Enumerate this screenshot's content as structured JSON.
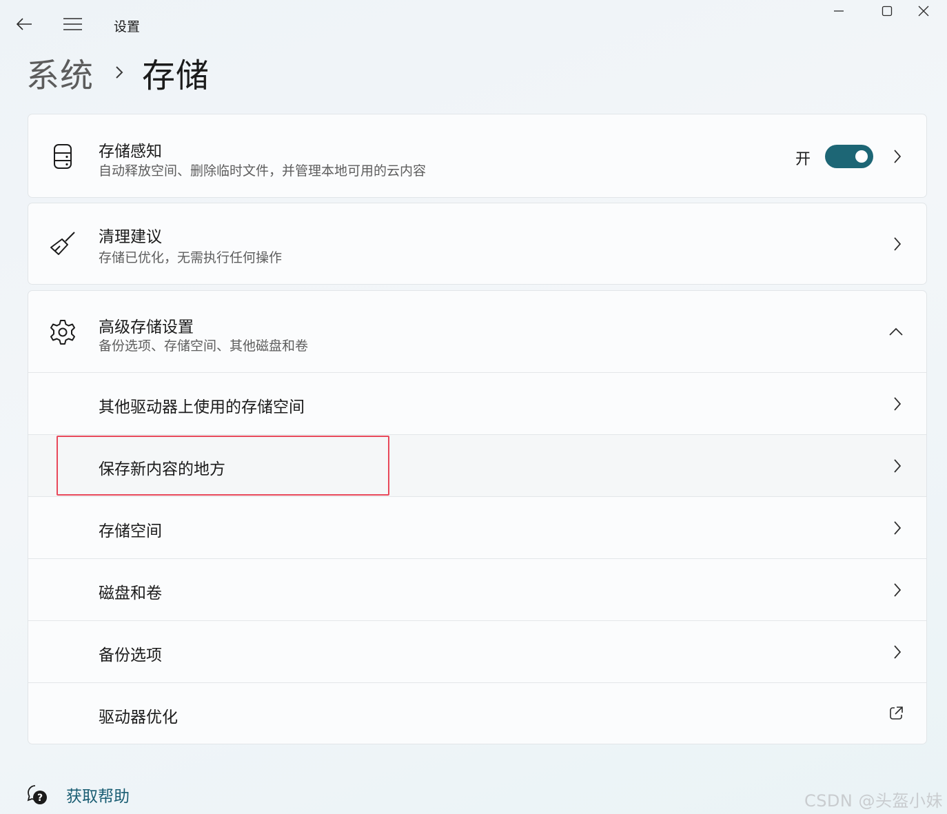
{
  "window": {
    "title": "设置",
    "back_icon": "arrow-left-icon",
    "menu_icon": "hamburger-icon",
    "controls": [
      "minimize-icon",
      "maximize-icon",
      "close-icon"
    ]
  },
  "breadcrumb": {
    "parent": "系统",
    "separator_icon": "chevron-right-icon",
    "current": "存储"
  },
  "storage_sense": {
    "icon": "storage-drive-icon",
    "title": "存储感知",
    "subtitle": "自动释放空间、删除临时文件，并管理本地可用的云内容",
    "toggle_label": "开",
    "toggle_on": true
  },
  "cleanup": {
    "icon": "broom-icon",
    "title": "清理建议",
    "subtitle": "存储已优化，无需执行任何操作"
  },
  "advanced": {
    "icon": "gear-icon",
    "title": "高级存储设置",
    "subtitle": "备份选项、存储空间、其他磁盘和卷",
    "expanded": true,
    "items": [
      {
        "label": "其他驱动器上使用的存储空间",
        "action_icon": "chevron-right-icon"
      },
      {
        "label": "保存新内容的地方",
        "action_icon": "chevron-right-icon",
        "highlighted": true
      },
      {
        "label": "存储空间",
        "action_icon": "chevron-right-icon"
      },
      {
        "label": "磁盘和卷",
        "action_icon": "chevron-right-icon"
      },
      {
        "label": "备份选项",
        "action_icon": "chevron-right-icon"
      },
      {
        "label": "驱动器优化",
        "action_icon": "external-link-icon"
      }
    ]
  },
  "help": {
    "icon": "help-chat-icon",
    "label": "获取帮助"
  },
  "watermark": "CSDN @头盔小妹",
  "colors": {
    "accent": "#1d6675",
    "link": "#1a5d73",
    "highlight": "#e8485a"
  }
}
